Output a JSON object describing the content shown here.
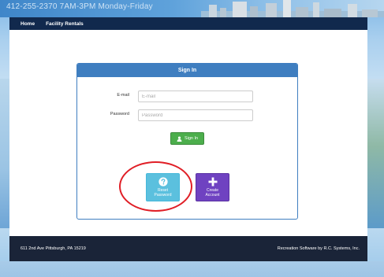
{
  "banner": {
    "text": "412-255-2370    7AM-3PM Monday-Friday"
  },
  "nav": {
    "items": [
      {
        "label": "Home"
      },
      {
        "label": "Facility Rentals"
      }
    ]
  },
  "signin": {
    "title": "Sign In",
    "email_label": "E-mail",
    "email_placeholder": "E-mail",
    "password_label": "Password",
    "password_placeholder": "Password",
    "button_label": "Sign In",
    "button_icon": "user-icon"
  },
  "tiles": {
    "reset": {
      "line1": "Reset",
      "line2": "Password",
      "icon": "question-circle-icon"
    },
    "create": {
      "line1": "Create",
      "line2": "Account",
      "icon": "plus-icon"
    }
  },
  "footer": {
    "address": "611 2nd Ave Pittsburgh, PA 15219",
    "credit": "Recreation Software by R.C. Systems, Inc."
  },
  "colors": {
    "nav_bg": "#11294d",
    "panel_accent": "#3f7ec0",
    "signin_green": "#4cae4c",
    "reset_cyan": "#5bc0de",
    "create_purple": "#6f42c1",
    "annotation_red": "#e01e26",
    "footer_bg": "#1a2438"
  }
}
